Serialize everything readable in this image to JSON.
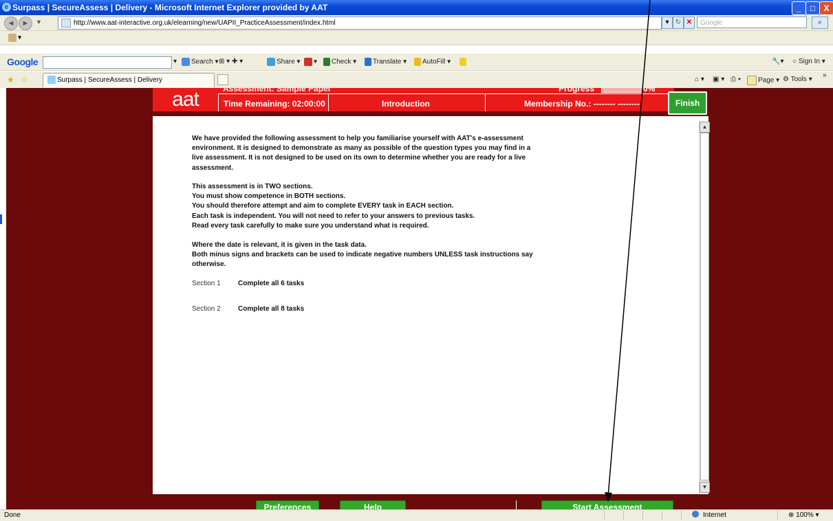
{
  "window": {
    "title": "Surpass | SecureAssess | Delivery - Microsoft Internet Explorer provided by AAT",
    "buttons": [
      "_",
      "□",
      "X"
    ]
  },
  "address_bar": {
    "url": "http://www.aat-interactive.org.uk/elearning/new/UAPII_PracticeAssessment/index.html",
    "search_placeholder": "Google"
  },
  "google_toolbar": {
    "logo": "Google",
    "items": [
      "Search",
      "Share",
      "Check",
      "Translate",
      "AutoFill"
    ],
    "sign_in": "Sign In"
  },
  "tab": {
    "label": "Surpass | SecureAssess | Delivery"
  },
  "command_bar": {
    "page": "Page",
    "tools": "Tools"
  },
  "app": {
    "logo": "aat",
    "assessment_label": "Assessment: Sample Paper",
    "progress_label": "Progress",
    "progress_percent": "0%",
    "progress_value": 0,
    "time_remaining": "Time Remaining: 02:00:00",
    "section_title": "Introduction",
    "membership": "Membership No.: -------- --------",
    "finish_label": "Finish"
  },
  "intro": {
    "para1": [
      "We have provided the following assessment to help you familiarise yourself with AAT's e-assessment",
      "environment. It is designed to demonstrate as many as possible of the question types you may find in a",
      "live assessment. It is not designed to be used on its own to determine whether you are ready for a live",
      "assessment."
    ],
    "para2": [
      "This assessment is in TWO sections.",
      "You must show competence in BOTH sections.",
      "You should therefore attempt and aim to complete EVERY task in EACH section.",
      "Each task is independent. You will not need to refer to your answers to previous tasks.",
      "Read every task carefully to make sure you understand what is required."
    ],
    "para3": [
      "Where the date is relevant, it is given in the task data.",
      "Both minus signs and brackets can be used to indicate negative numbers UNLESS task instructions say",
      "otherwise."
    ],
    "sections": [
      {
        "label": "Section 1",
        "desc": "Complete all 6 tasks"
      },
      {
        "label": "Section 2",
        "desc": "Complete all 8 tasks"
      }
    ]
  },
  "footer_buttons": {
    "preferences": "Preferences",
    "help": "Help",
    "start": "Start Assessment"
  },
  "status_bar": {
    "text": "Done",
    "zone": "Internet",
    "zoom": "100%"
  }
}
